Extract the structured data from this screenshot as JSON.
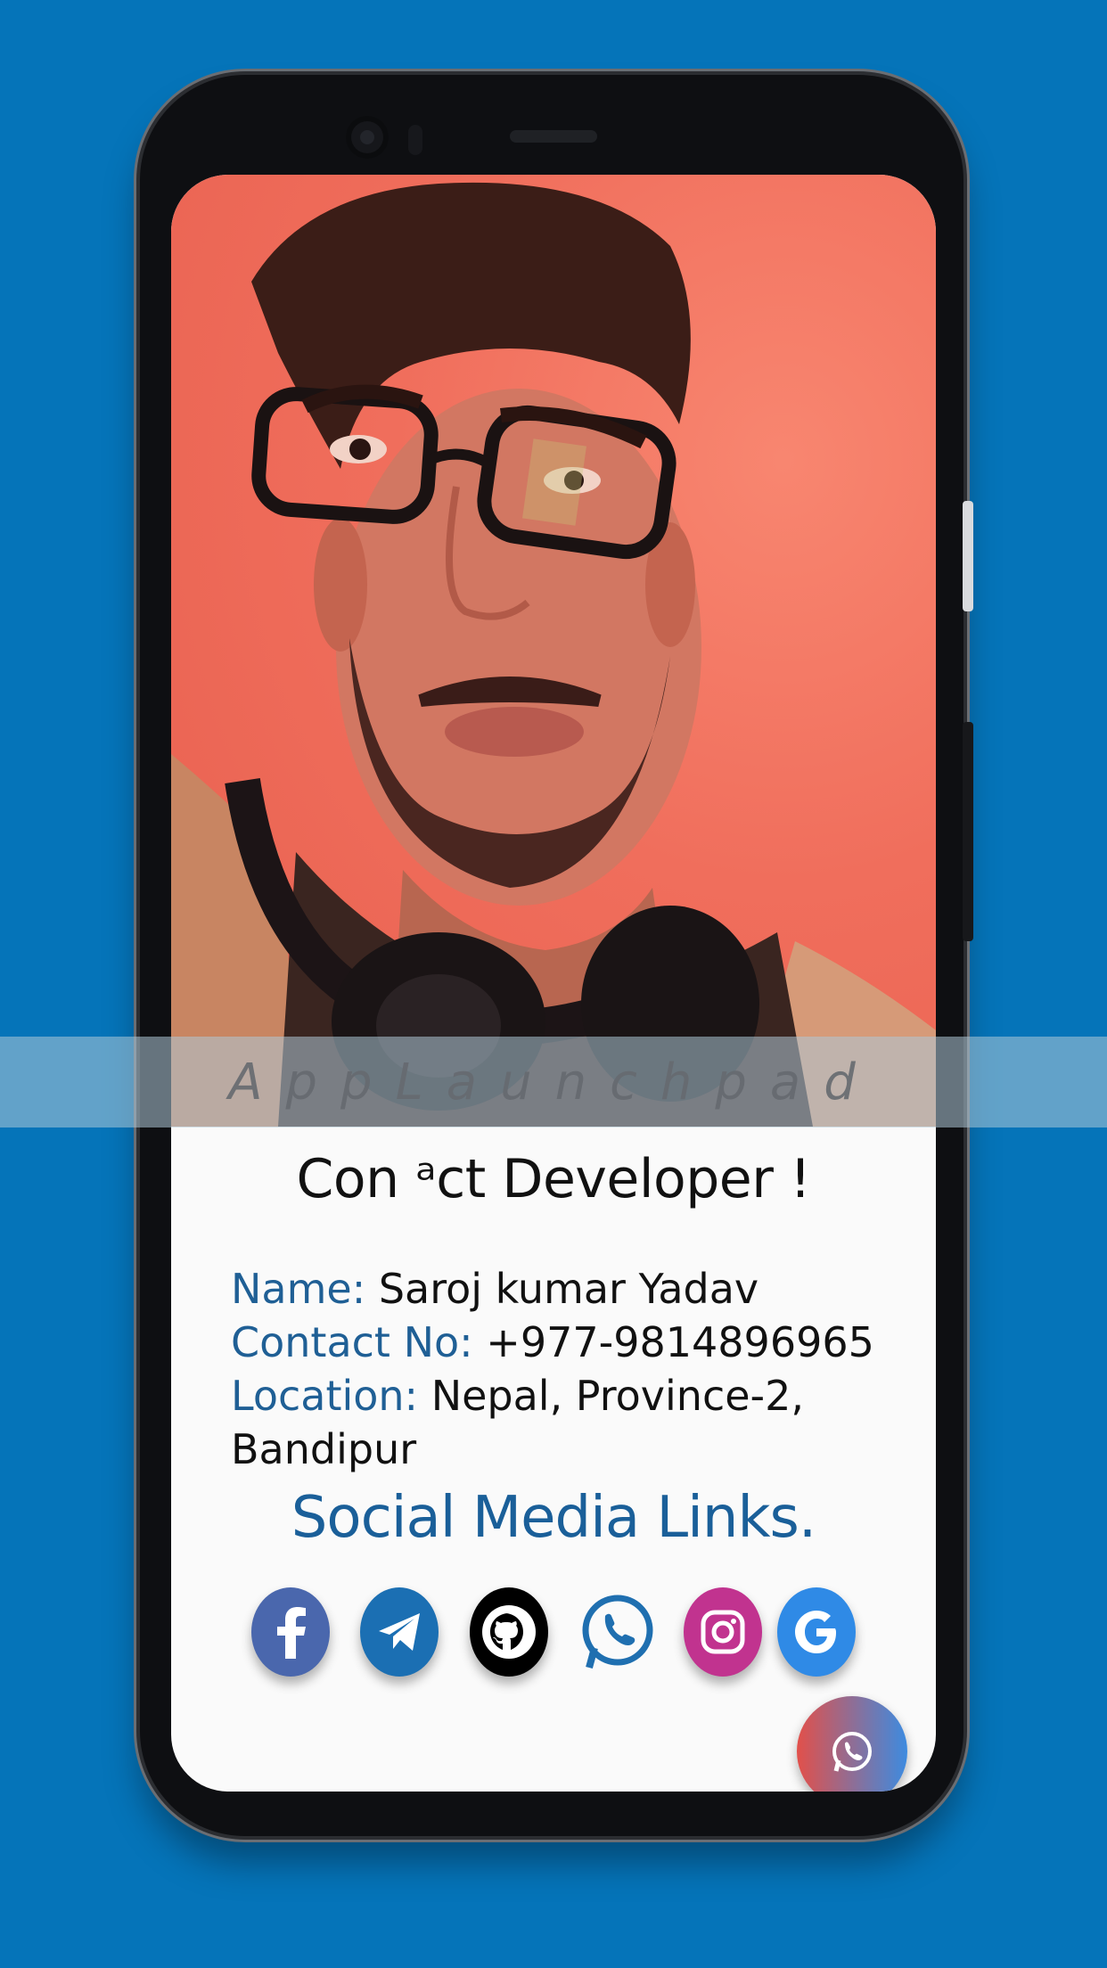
{
  "banner": {
    "watermark": "AppLaunchpad"
  },
  "contact": {
    "title": "Con ᵃct Developer !",
    "name_label": "Name:",
    "name_value": "Saroj kumar Yadav",
    "contact_label": "Contact No:",
    "contact_value": "+977-9814896965",
    "location_label": "Location:",
    "location_value": "Nepal, Province-2, Bandipur"
  },
  "social": {
    "title": "Social Media Links.",
    "icons": [
      "facebook-icon",
      "telegram-icon",
      "github-icon",
      "whatsapp-icon",
      "instagram-icon",
      "google-icon"
    ]
  },
  "colors": {
    "background": "#0574b9",
    "label_blue": "#1f5f95",
    "facebook": "#4a67ad",
    "telegram": "#1b6fb3",
    "github": "#000000",
    "instagram": "#c1338f",
    "google": "#2f8ae6"
  },
  "fab": {
    "icon": "whatsapp-icon"
  }
}
